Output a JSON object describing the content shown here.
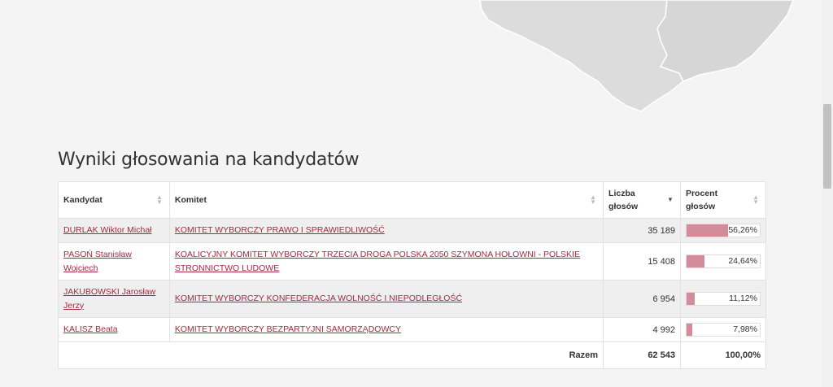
{
  "heading": "Wyniki głosowania na kandydatów",
  "table": {
    "headers": {
      "candidate": "Kandydat",
      "committee": "Komitet",
      "votes": "Liczba głosów",
      "percent": "Procent głosów"
    },
    "rows": [
      {
        "candidate": "DURLAK Wiktor Michał",
        "committee": "KOMITET WYBORCZY PRAWO I SPRAWIEDLIWOŚĆ",
        "votes": "35 189",
        "percent": "56,26%",
        "percent_value": 56.26
      },
      {
        "candidate": "PASOŃ Stanisław Wojciech",
        "committee": "KOALICYJNY KOMITET WYBORCZY TRZECIA DROGA POLSKA 2050 SZYMONA HOŁOWNI - POLSKIE STRONNICTWO LUDOWE",
        "votes": "15 408",
        "percent": "24,64%",
        "percent_value": 24.64
      },
      {
        "candidate": "JAKUBOWSKI Jarosław Jerzy",
        "committee": "KOMITET WYBORCZY KONFEDERACJA WOLNOŚĆ I NIEPODLEGŁOŚĆ",
        "votes": "6 954",
        "percent": "11,12%",
        "percent_value": 11.12
      },
      {
        "candidate": "KALISZ Beata",
        "committee": "KOMITET WYBORCZY BEZPARTYJNI SAMORZĄDOWCY",
        "votes": "4 992",
        "percent": "7,98%",
        "percent_value": 7.98
      }
    ],
    "footer": {
      "label": "Razem",
      "votes": "62 543",
      "percent": "100,00%"
    }
  },
  "colors": {
    "link": "#a8283f",
    "bar": "#d28c9a",
    "map_fill": "#dcdcdc"
  }
}
